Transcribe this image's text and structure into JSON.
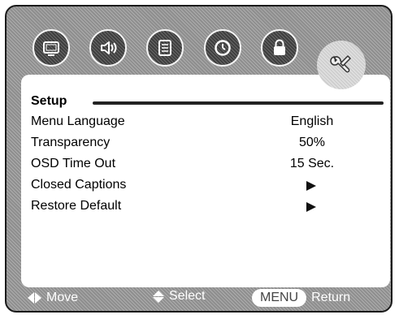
{
  "tabs": [
    {
      "icon": "tv-screen-icon"
    },
    {
      "icon": "speaker-icon"
    },
    {
      "icon": "document-icon"
    },
    {
      "icon": "clock-icon"
    },
    {
      "icon": "lock-icon"
    },
    {
      "icon": "wrench-icon",
      "active": true
    }
  ],
  "panel": {
    "title": "Setup",
    "items": [
      {
        "label": "Menu Language",
        "value": "English"
      },
      {
        "label": "Transparency",
        "value": "50%"
      },
      {
        "label": "OSD Time Out",
        "value": "15 Sec."
      },
      {
        "label": "Closed Captions",
        "value": "",
        "submenu": true
      },
      {
        "label": "Restore Default",
        "value": "",
        "submenu": true
      }
    ]
  },
  "footer": {
    "move": "Move",
    "select": "Select",
    "menu_key": "MENU",
    "return": "Return"
  },
  "colors": {
    "frame_bg": "#8e8e8e",
    "icon_bg": "#3e3e3e",
    "active_icon_bg": "#cfcfcf",
    "panel_bg": "#ffffff"
  }
}
